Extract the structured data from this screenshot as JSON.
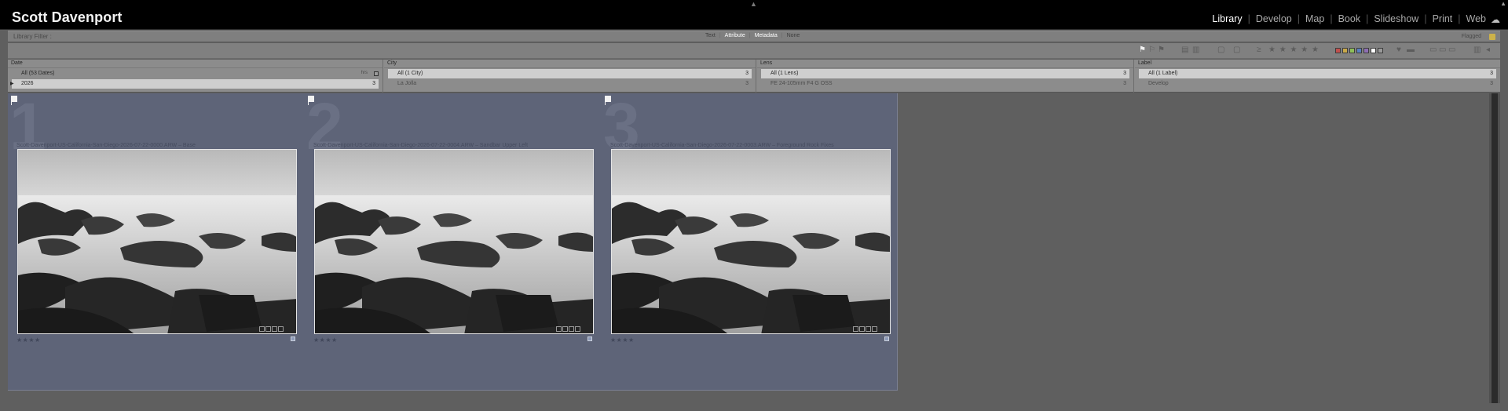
{
  "app": {
    "identity_plate": "Scott Davenport",
    "modules": [
      {
        "label": "Library",
        "active": true
      },
      {
        "label": "Develop",
        "active": false
      },
      {
        "label": "Map",
        "active": false
      },
      {
        "label": "Book",
        "active": false
      },
      {
        "label": "Slideshow",
        "active": false
      },
      {
        "label": "Print",
        "active": false
      },
      {
        "label": "Web",
        "active": false
      }
    ],
    "separator": "|"
  },
  "filter_bar": {
    "label": "Library Filter :",
    "options": [
      {
        "label": "Text",
        "active": false
      },
      {
        "label": "Attribute",
        "active": true
      },
      {
        "label": "Metadata",
        "active": true
      },
      {
        "label": "None",
        "active": false
      }
    ],
    "preset": "Flagged"
  },
  "browser": {
    "columns": [
      {
        "header": "Date",
        "rows": [
          {
            "label": "All (53 Dates)",
            "count": "",
            "selected": false,
            "icon": "hrs"
          },
          {
            "label": "2026",
            "count": "3",
            "selected": true,
            "expandable": true
          }
        ]
      },
      {
        "header": "City",
        "rows": [
          {
            "label": "All (1 City)",
            "count": "3",
            "selected": true
          },
          {
            "label": "La Jolla",
            "count": "3",
            "selected": false
          }
        ]
      },
      {
        "header": "Lens",
        "rows": [
          {
            "label": "All (1 Lens)",
            "count": "3",
            "selected": true
          },
          {
            "label": "FE 24-105mm F4 G OSS",
            "count": "3",
            "selected": false
          }
        ]
      },
      {
        "header": "Label",
        "rows": [
          {
            "label": "All (1 Label)",
            "count": "3",
            "selected": true
          },
          {
            "label": "Develop",
            "count": "3",
            "selected": false
          }
        ]
      }
    ]
  },
  "grid": {
    "cells": [
      {
        "index": "1",
        "filename": "Scott-Davenport-US-California-San-Diego-2026-07-22-0000.ARW  –  Base",
        "rating": "★★★★"
      },
      {
        "index": "2",
        "filename": "Scott-Davenport-US-California-San-Diego-2026-07-22-0004.ARW  –  Sandbar Upper Left",
        "rating": "★★★★"
      },
      {
        "index": "3",
        "filename": "Scott-Davenport-US-California-San-Diego-2026-07-22-0003.ARW  –  Foreground Rock Fixes",
        "rating": "★★★★"
      }
    ]
  },
  "colors": {
    "selection_bg": "#5e6478",
    "label_swatches": [
      "#c0504d",
      "#c9a94a",
      "#8fbf5a",
      "#5a7fc0",
      "#8e6fb3",
      "#ffffff",
      "#9a9a9a"
    ]
  }
}
